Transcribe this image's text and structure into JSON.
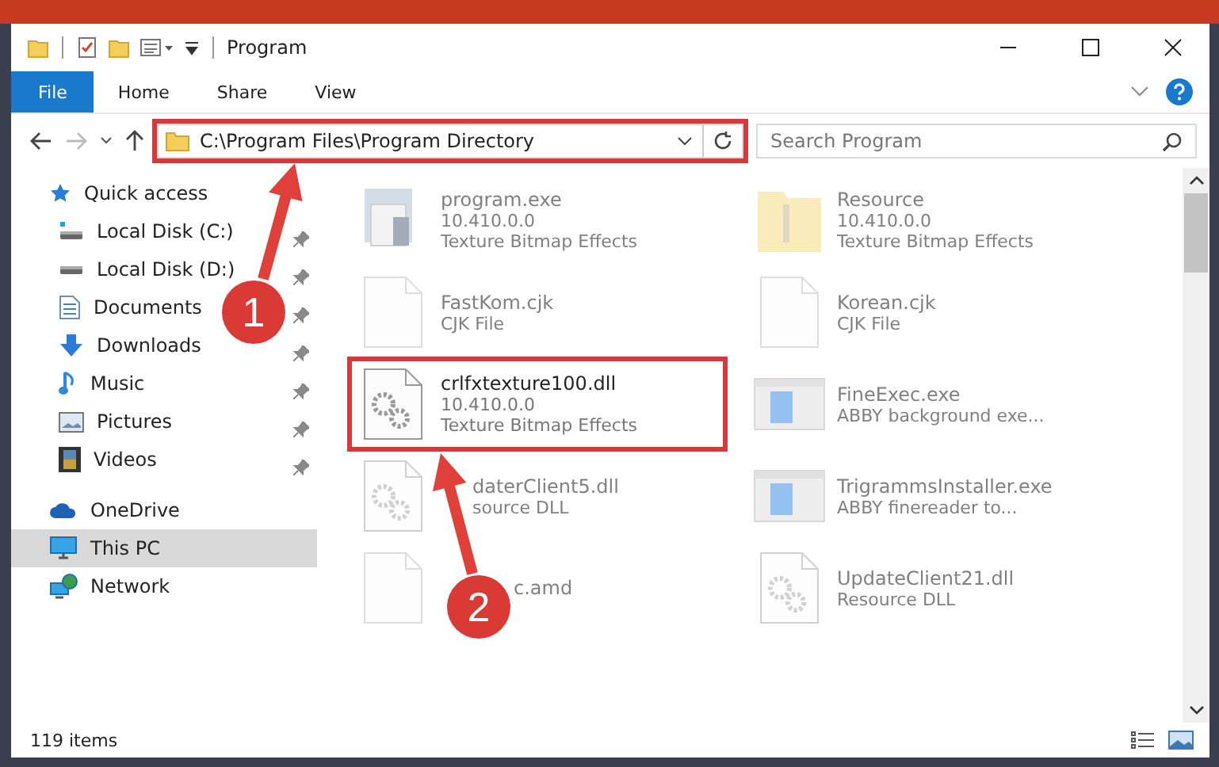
{
  "window": {
    "title": "Program"
  },
  "ribbon": {
    "tabs": [
      {
        "label": "File",
        "selected": true
      },
      {
        "label": "Home",
        "selected": false
      },
      {
        "label": "Share",
        "selected": false
      },
      {
        "label": "View",
        "selected": false
      }
    ]
  },
  "address_bar": {
    "path": "C:\\Program Files\\Program Directory",
    "highlighted": true
  },
  "search": {
    "placeholder": "Search Program"
  },
  "sidebar": {
    "items": [
      {
        "label": "Quick access",
        "kind": "star",
        "selected": false,
        "children": [
          {
            "label": "Local Disk (C:)",
            "kind": "disk-c",
            "selected": false,
            "pinned": true
          },
          {
            "label": "Local Disk (D:)",
            "kind": "disk",
            "selected": false,
            "pinned": true
          },
          {
            "label": "Documents",
            "kind": "documents",
            "selected": false,
            "pinned": true
          },
          {
            "label": "Downloads",
            "kind": "downloads",
            "selected": false,
            "pinned": true
          },
          {
            "label": "Music",
            "kind": "music",
            "selected": false,
            "pinned": true
          },
          {
            "label": "Pictures",
            "kind": "pictures",
            "selected": false,
            "pinned": true
          },
          {
            "label": "Videos",
            "kind": "videos",
            "selected": false,
            "pinned": true
          }
        ]
      },
      {
        "label": "OneDrive",
        "kind": "cloud",
        "selected": false
      },
      {
        "label": "This PC",
        "kind": "pc",
        "selected": true
      },
      {
        "label": "Network",
        "kind": "network",
        "selected": false
      }
    ]
  },
  "files": [
    {
      "name": "program.exe",
      "details": [
        "10.410.0.0",
        "Texture Bitmap Effects"
      ],
      "kind": "installer",
      "blurred": true,
      "highlighted": false
    },
    {
      "name": "Resource",
      "details": [
        "10.410.0.0",
        "Texture Bitmap Effects"
      ],
      "kind": "folder",
      "blurred": true,
      "highlighted": false
    },
    {
      "name": "FastKom.cjk",
      "details": [
        "CJK File"
      ],
      "kind": "blank",
      "blurred": true,
      "highlighted": false
    },
    {
      "name": "Korean.cjk",
      "details": [
        "CJK File"
      ],
      "kind": "blank",
      "blurred": true,
      "highlighted": false
    },
    {
      "name": "crlfxtexture100.dll",
      "details": [
        "10.410.0.0",
        "Texture Bitmap Effects"
      ],
      "kind": "dll",
      "blurred": false,
      "highlighted": true
    },
    {
      "name": "FineExec.exe",
      "details": [
        "ABBY background exe..."
      ],
      "kind": "app",
      "blurred": true,
      "highlighted": false
    },
    {
      "name": "daterClient5.dll",
      "details": [
        "source DLL"
      ],
      "kind": "dll",
      "blurred": true,
      "highlighted": false
    },
    {
      "name": "TrigrammsInstaller.exe",
      "details": [
        "ABBY finereader to..."
      ],
      "kind": "app",
      "blurred": true,
      "highlighted": false
    },
    {
      "name": "c.amd",
      "kind": "blank",
      "blurred": true,
      "highlighted": false
    },
    {
      "name": "UpdateClient21.dll",
      "details": [
        "Resource DLL"
      ],
      "kind": "dll",
      "blurred": true,
      "highlighted": false
    }
  ],
  "annotations": [
    {
      "label": "1"
    },
    {
      "label": "2"
    }
  ],
  "status_bar": {
    "count": "119 items"
  }
}
